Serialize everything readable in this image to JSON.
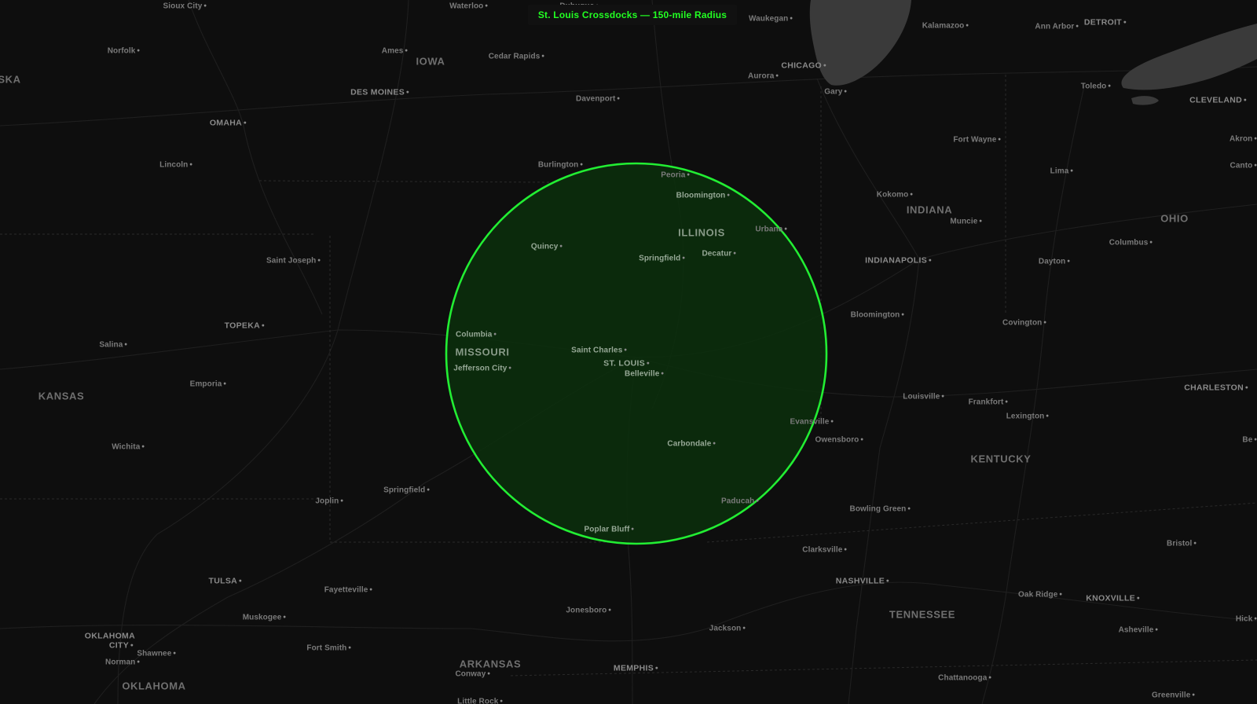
{
  "map": {
    "title": "St. Louis Crossdocks — 150-mile Radius",
    "center_label": "ST. LOUIS",
    "radius_miles": 150,
    "colors": {
      "background": "#0e0e0e",
      "water": "#3a3a3a",
      "roads": "#1f1f1f",
      "borders": "#2a2a2a",
      "radius_stroke": "#22ee33",
      "radius_fill": "#0b2f0d",
      "title_text": "#22ff22"
    },
    "labels": [
      {
        "id": "sioux-city",
        "text": "Sioux City",
        "kind": "city"
      },
      {
        "id": "waterloo",
        "text": "Waterloo",
        "kind": "city"
      },
      {
        "id": "dubuque",
        "text": "Dubuque",
        "kind": "city"
      },
      {
        "id": "waukegan",
        "text": "Waukegan",
        "kind": "city"
      },
      {
        "id": "kalamazoo",
        "text": "Kalamazoo",
        "kind": "city"
      },
      {
        "id": "ann-arbor",
        "text": "Ann Arbor",
        "kind": "city"
      },
      {
        "id": "detroit",
        "text": "DETROIT",
        "kind": "major"
      },
      {
        "id": "norfolk",
        "text": "Norfolk",
        "kind": "city"
      },
      {
        "id": "ames",
        "text": "Ames",
        "kind": "city"
      },
      {
        "id": "iowa",
        "text": "IOWA",
        "kind": "state"
      },
      {
        "id": "cedar-rapids",
        "text": "Cedar Rapids",
        "kind": "city"
      },
      {
        "id": "chicago",
        "text": "CHICAGO",
        "kind": "major"
      },
      {
        "id": "aska",
        "text": "SKA",
        "kind": "state"
      },
      {
        "id": "aurora",
        "text": "Aurora",
        "kind": "city"
      },
      {
        "id": "des-moines",
        "text": "DES MOINES",
        "kind": "major"
      },
      {
        "id": "gary",
        "text": "Gary",
        "kind": "city"
      },
      {
        "id": "toledo",
        "text": "Toledo",
        "kind": "city"
      },
      {
        "id": "davenport",
        "text": "Davenport",
        "kind": "city"
      },
      {
        "id": "cleveland",
        "text": "CLEVELAND",
        "kind": "major"
      },
      {
        "id": "omaha",
        "text": "OMAHA",
        "kind": "major"
      },
      {
        "id": "fort-wayne",
        "text": "Fort Wayne",
        "kind": "city"
      },
      {
        "id": "akron",
        "text": "Akron",
        "kind": "city"
      },
      {
        "id": "lincoln",
        "text": "Lincoln",
        "kind": "city"
      },
      {
        "id": "burlington",
        "text": "Burlington",
        "kind": "city"
      },
      {
        "id": "peoria",
        "text": "Peoria",
        "kind": "city"
      },
      {
        "id": "canton",
        "text": "Canto",
        "kind": "city"
      },
      {
        "id": "lima",
        "text": "Lima",
        "kind": "city"
      },
      {
        "id": "bloomington-il",
        "text": "Bloomington",
        "kind": "city"
      },
      {
        "id": "kokomo",
        "text": "Kokomo",
        "kind": "city"
      },
      {
        "id": "indiana",
        "text": "INDIANA",
        "kind": "state"
      },
      {
        "id": "ohio",
        "text": "OHIO",
        "kind": "state"
      },
      {
        "id": "muncie",
        "text": "Muncie",
        "kind": "city"
      },
      {
        "id": "urbana",
        "text": "Urbana",
        "kind": "city"
      },
      {
        "id": "illinois",
        "text": "ILLINOIS",
        "kind": "state"
      },
      {
        "id": "columbus",
        "text": "Columbus",
        "kind": "city"
      },
      {
        "id": "quincy",
        "text": "Quincy",
        "kind": "city"
      },
      {
        "id": "decatur",
        "text": "Decatur",
        "kind": "city"
      },
      {
        "id": "springfield-il",
        "text": "Springfield",
        "kind": "city"
      },
      {
        "id": "saint-joseph",
        "text": "Saint Joseph",
        "kind": "city"
      },
      {
        "id": "indianapolis",
        "text": "INDIANAPOLIS",
        "kind": "major"
      },
      {
        "id": "dayton",
        "text": "Dayton",
        "kind": "city"
      },
      {
        "id": "bloomington-in",
        "text": "Bloomington",
        "kind": "city"
      },
      {
        "id": "topeka",
        "text": "TOPEKA",
        "kind": "major"
      },
      {
        "id": "covington",
        "text": "Covington",
        "kind": "city"
      },
      {
        "id": "columbia",
        "text": "Columbia",
        "kind": "city"
      },
      {
        "id": "salina",
        "text": "Salina",
        "kind": "city"
      },
      {
        "id": "saint-charles",
        "text": "Saint Charles",
        "kind": "city"
      },
      {
        "id": "missouri",
        "text": "MISSOURI",
        "kind": "state"
      },
      {
        "id": "st-louis",
        "text": "ST. LOUIS",
        "kind": "major"
      },
      {
        "id": "jefferson-city",
        "text": "Jefferson City",
        "kind": "city"
      },
      {
        "id": "belleville",
        "text": "Belleville",
        "kind": "city"
      },
      {
        "id": "emporia",
        "text": "Emporia",
        "kind": "city"
      },
      {
        "id": "charleston",
        "text": "CHARLESTON",
        "kind": "major"
      },
      {
        "id": "kansas",
        "text": "KANSAS",
        "kind": "state"
      },
      {
        "id": "louisville",
        "text": "Louisville",
        "kind": "city"
      },
      {
        "id": "frankfort",
        "text": "Frankfort",
        "kind": "city"
      },
      {
        "id": "lexington",
        "text": "Lexington",
        "kind": "city"
      },
      {
        "id": "evansville",
        "text": "Evansville",
        "kind": "city"
      },
      {
        "id": "owensboro",
        "text": "Owensboro",
        "kind": "city"
      },
      {
        "id": "carbondale",
        "text": "Carbondale",
        "kind": "city"
      },
      {
        "id": "wichita",
        "text": "Wichita",
        "kind": "city"
      },
      {
        "id": "kentucky",
        "text": "KENTUCKY",
        "kind": "state"
      },
      {
        "id": "springfield-mo",
        "text": "Springfield",
        "kind": "city"
      },
      {
        "id": "joplin",
        "text": "Joplin",
        "kind": "city"
      },
      {
        "id": "paducah",
        "text": "Paducah",
        "kind": "city"
      },
      {
        "id": "bowling-green",
        "text": "Bowling Green",
        "kind": "city"
      },
      {
        "id": "poplar-bluff",
        "text": "Poplar Bluff",
        "kind": "city"
      },
      {
        "id": "bristol",
        "text": "Bristol",
        "kind": "city"
      },
      {
        "id": "clarksville",
        "text": "Clarksville",
        "kind": "city"
      },
      {
        "id": "tulsa",
        "text": "TULSA",
        "kind": "major"
      },
      {
        "id": "nashville",
        "text": "NASHVILLE",
        "kind": "major"
      },
      {
        "id": "fayetteville",
        "text": "Fayetteville",
        "kind": "city"
      },
      {
        "id": "oak-ridge",
        "text": "Oak Ridge",
        "kind": "city"
      },
      {
        "id": "knoxville",
        "text": "KNOXVILLE",
        "kind": "major"
      },
      {
        "id": "jonesboro",
        "text": "Jonesboro",
        "kind": "city"
      },
      {
        "id": "tennessee",
        "text": "TENNESSEE",
        "kind": "state"
      },
      {
        "id": "muskogee",
        "text": "Muskogee",
        "kind": "city"
      },
      {
        "id": "hickory",
        "text": "Hick",
        "kind": "city"
      },
      {
        "id": "asheville",
        "text": "Asheville",
        "kind": "city"
      },
      {
        "id": "jackson",
        "text": "Jackson",
        "kind": "city"
      },
      {
        "id": "oklahoma-city-1",
        "text": "OKLAHOMA",
        "kind": "major"
      },
      {
        "id": "oklahoma-city-2",
        "text": "CITY",
        "kind": "major"
      },
      {
        "id": "fort-smith",
        "text": "Fort Smith",
        "kind": "city"
      },
      {
        "id": "shawnee",
        "text": "Shawnee",
        "kind": "city"
      },
      {
        "id": "arkansas",
        "text": "ARKANSAS",
        "kind": "state"
      },
      {
        "id": "norman",
        "text": "Norman",
        "kind": "city"
      },
      {
        "id": "memphis",
        "text": "MEMPHIS",
        "kind": "major"
      },
      {
        "id": "conway",
        "text": "Conway",
        "kind": "city"
      },
      {
        "id": "chattanooga",
        "text": "Chattanooga",
        "kind": "city"
      },
      {
        "id": "oklahoma",
        "text": "OKLAHOMA",
        "kind": "state"
      },
      {
        "id": "greenville",
        "text": "Greenville",
        "kind": "city"
      },
      {
        "id": "little-rock",
        "text": "Little Rock",
        "kind": "city"
      },
      {
        "id": "be",
        "text": "Be",
        "kind": "city"
      }
    ]
  }
}
